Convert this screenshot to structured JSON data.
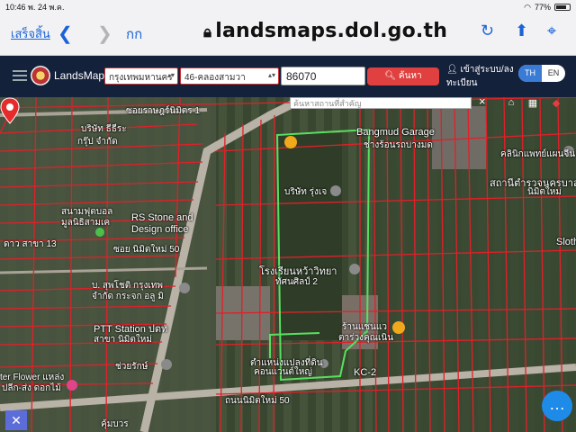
{
  "status_bar": {
    "time": "10:46",
    "date": "พ. 24 พ.ค.",
    "battery": "77%"
  },
  "safari": {
    "done_label": "เสร็จสิ้น",
    "back_icon": "chevron-left-icon",
    "forward_icon": "chevron-right-icon",
    "text_size_label": "กก",
    "url": "landsmaps.dol.go.th",
    "reload_icon": "reload-icon",
    "share_icon": "share-icon",
    "compass_icon": "compass-icon"
  },
  "toolbar": {
    "brand": "LandsMaps",
    "province": "กรุงเทพมหานคร",
    "district": "46-คลองสามวา",
    "parcel_number": "86070",
    "search_label": "ค้นหา",
    "login_label_line1": "เข้าสู่ระบบ/ลง",
    "login_label_line2": "ทะเบียน",
    "lang_th": "TH",
    "lang_en": "EN",
    "accent_color": "#e0403f",
    "bar_color": "#14213b"
  },
  "map": {
    "place_search_placeholder": "ค้นหาสถานที่สำคัญ",
    "close_label": "×",
    "labels": {
      "l1": "ซอยราษฎร์นิมิตร 1",
      "l2": "บริษัท ธีธีระ",
      "l3": "กรุ๊ป จำกัด",
      "l4": "สนามฟุตบอล",
      "l5": "มูลนิธิสามเค",
      "l6": "RS Stone and",
      "l7": "Design office",
      "l8": "ดาว สาขา 13",
      "l9": "ซอย นิมิตใหม่ 50",
      "l10": "บ. สุพโชติ กรุงเทพ",
      "l11": "จำกัด กระจก อลู มิ",
      "l12": "PTT Station ปตท",
      "l13": "สาขา นิมิตใหม่",
      "l14": "ช่วยรักษ์",
      "l15": "ter Flower แหล่ง",
      "l16": "ปลีก-ส่ง ดอกไม้",
      "l17": "Bangmud Garage",
      "l18": "ช่างร้อนรถบางมด",
      "l19": "บริษัท รุ่งเจ",
      "l20": "โรงเรียนหว้าวิทยา",
      "l21": "ทัศนศิลป์ 2",
      "l22": "ร้านแชนแว",
      "l23": "ตาร่วงคุณเนิน",
      "l24": "KC-2",
      "l25": "ถนนนิมิตใหม่ 50",
      "l26": "คลินิกแพทย์แผนจีน",
      "l27": "สถานีตำรวจนครบาล",
      "l28": "นิมิตใหม่",
      "l29": "Sloth",
      "l30": "ตำแหน่งแปลงที่ดิน",
      "l31": "คอนแวนต์ใหญ่",
      "l32": "คุ้มบวร"
    }
  },
  "colors": {
    "parcel_lines": "#e0202a",
    "selected_boundary": "#57e05f",
    "road": "#b9b2a6"
  }
}
